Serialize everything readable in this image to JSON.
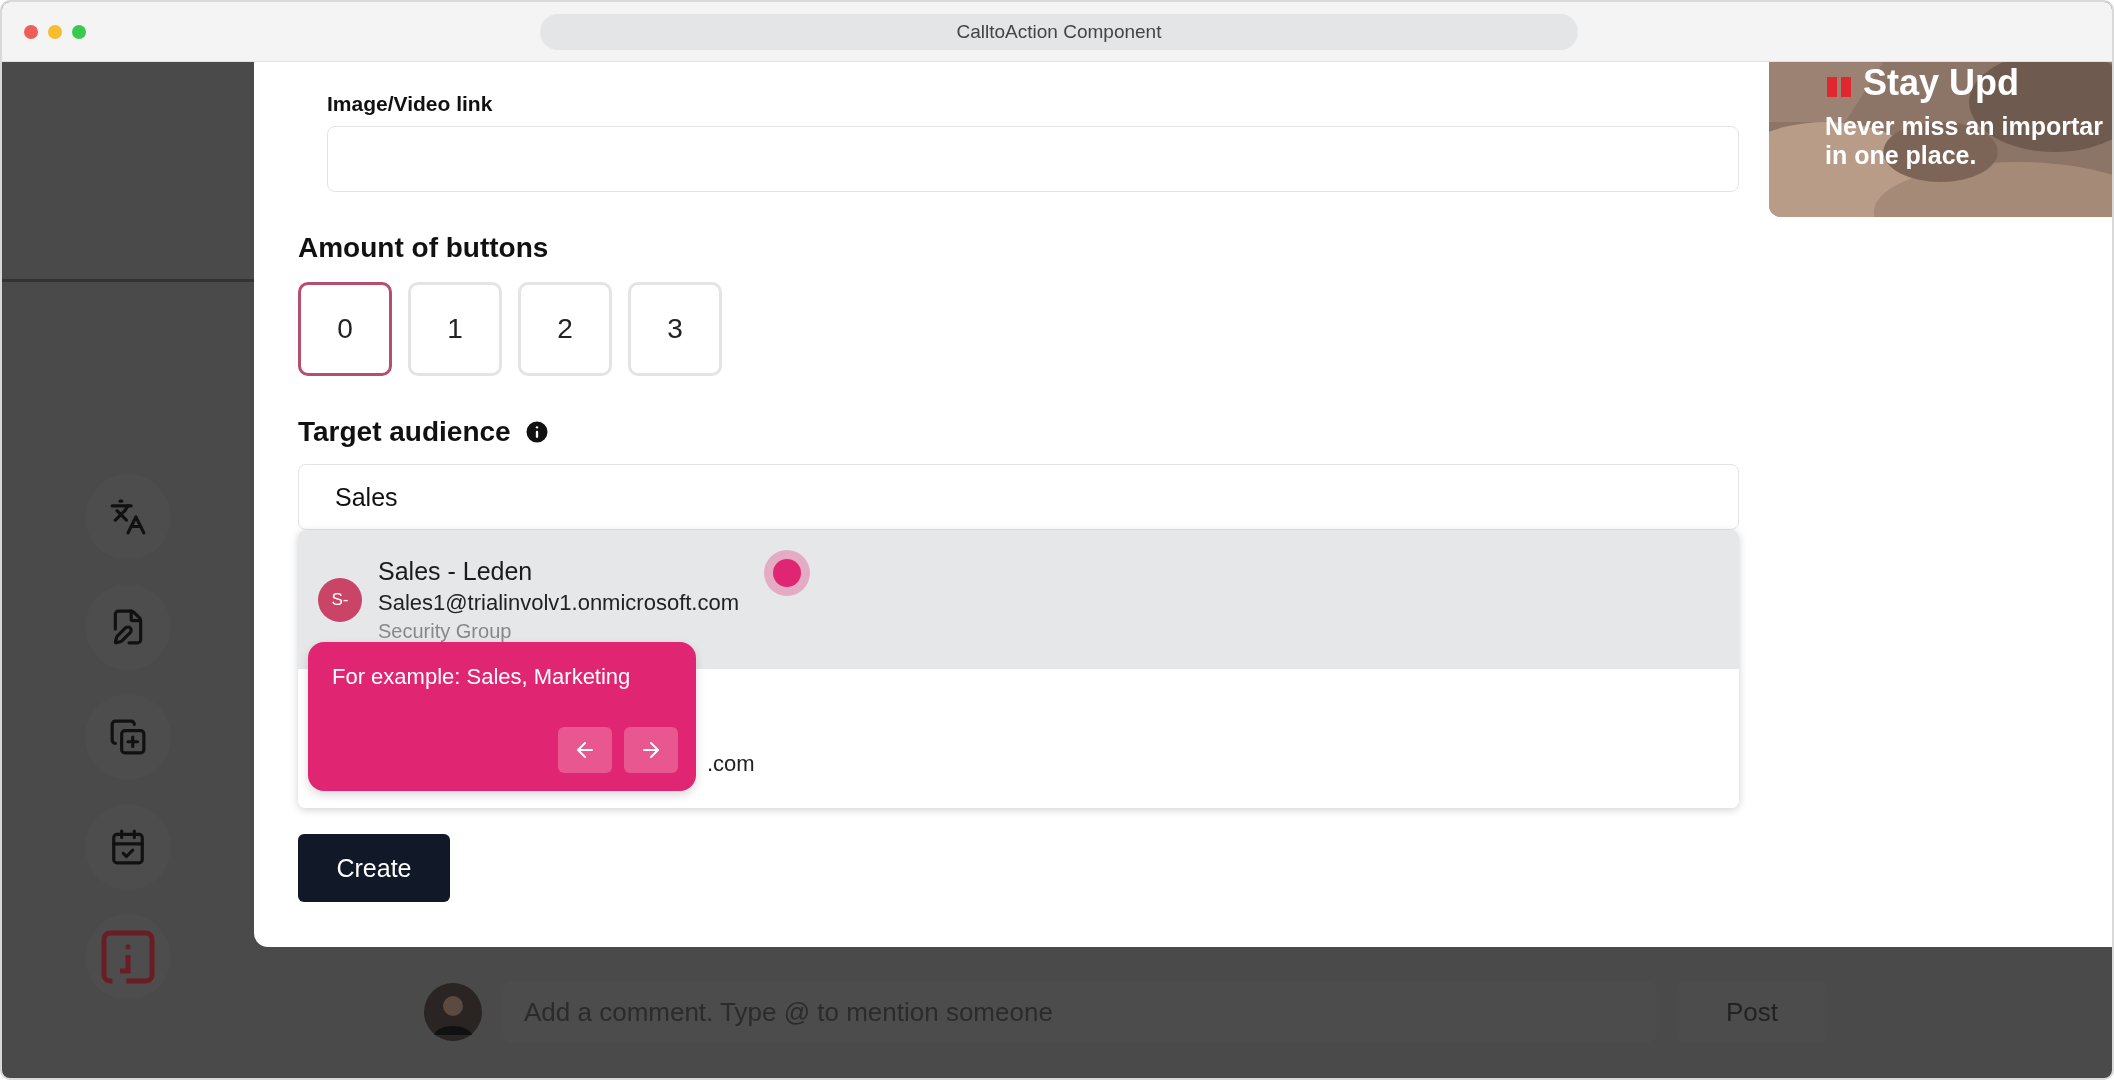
{
  "window": {
    "title": "CalltoAction Component"
  },
  "form": {
    "image_link": {
      "label": "Image/Video link"
    },
    "amount_of_buttons": {
      "label": "Amount of buttons",
      "options": [
        {
          "label": "0",
          "selected": true
        },
        {
          "label": "1",
          "selected": false
        },
        {
          "label": "2",
          "selected": false
        },
        {
          "label": "3",
          "selected": false
        }
      ]
    },
    "target_audience": {
      "label": "Target audience",
      "search": {
        "value": "Sales"
      },
      "results": [
        {
          "avatar": "S-",
          "name": "Sales - Leden",
          "email": "Sales1@trialinvolv1.onmicrosoft.com",
          "type": "Security Group",
          "highlighted": true
        },
        {
          "email": ".com",
          "highlighted": false
        }
      ]
    },
    "create_button": "Create"
  },
  "preview_card": {
    "title": "Stay Upd",
    "lines": [
      "Never miss an importar",
      "in one place."
    ]
  },
  "tour_tooltip": {
    "text": "For example: Sales, Marketing"
  },
  "comment_bar": {
    "placeholder": "Add a comment. Type @ to mention someone",
    "post": "Post"
  }
}
